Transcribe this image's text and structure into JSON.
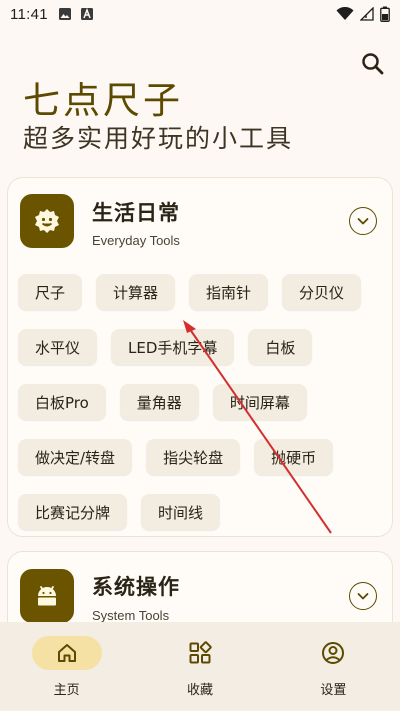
{
  "status_bar": {
    "time": "11:41",
    "left_icons": [
      "image-icon",
      "a-app-icon"
    ],
    "right_icons": [
      "wifi-icon",
      "signal-icon",
      "battery-icon"
    ]
  },
  "header": {
    "title": "七点尺子",
    "subtitle": "超多实用好玩的小工具",
    "search_icon": "search-icon"
  },
  "categories": [
    {
      "title": "生活日常",
      "subtitle": "Everyday Tools",
      "icon": "sun-face-icon",
      "expanded": true,
      "tools": [
        "尺子",
        "计算器",
        "指南针",
        "分贝仪",
        "水平仪",
        "LED手机字幕",
        "白板",
        "白板Pro",
        "量角器",
        "时间屏幕",
        "做决定/转盘",
        "指尖轮盘",
        "抛硬币",
        "比赛记分牌",
        "时间线"
      ]
    },
    {
      "title": "系统操作",
      "subtitle": "System Tools",
      "icon": "android-icon",
      "expanded": false,
      "tools": []
    }
  ],
  "annotation": {
    "type": "arrow",
    "color": "#d32f2f"
  },
  "bottom_nav": [
    {
      "label": "主页",
      "icon": "home-icon",
      "active": true
    },
    {
      "label": "收藏",
      "icon": "apps-grid-icon",
      "active": false
    },
    {
      "label": "设置",
      "icon": "profile-icon",
      "active": false
    }
  ],
  "colors": {
    "accent": "#6b5400",
    "background": "#fdf8f3",
    "chip_bg": "#f2ece1",
    "nav_active": "#f5e1a3"
  }
}
